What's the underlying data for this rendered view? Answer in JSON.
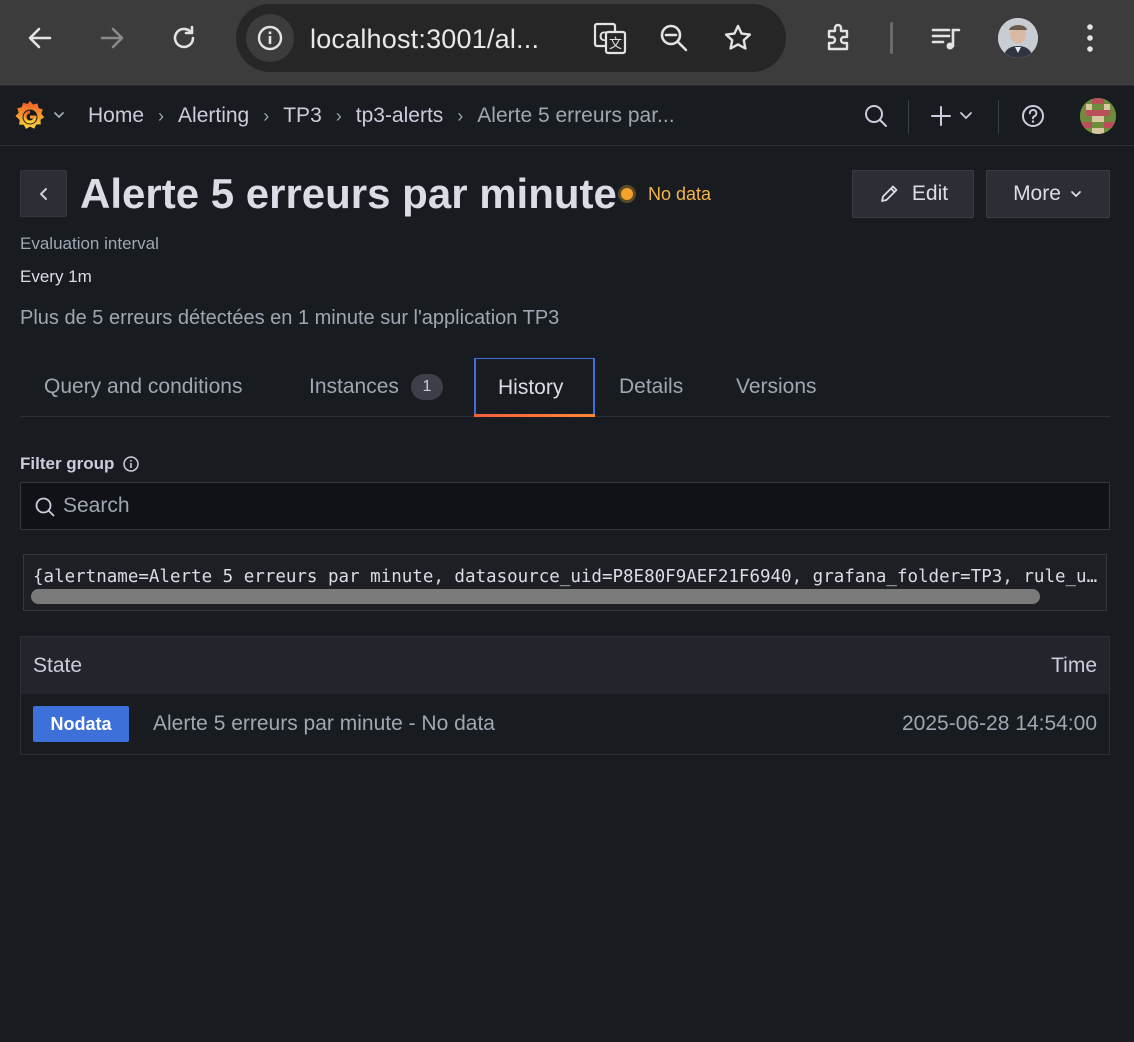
{
  "browser": {
    "url": "localhost:3001/al...",
    "colors": {
      "chrome_bg": "#3c3c3c",
      "omnibox_bg": "#262626"
    }
  },
  "grafana": {
    "breadcrumbs": [
      "Home",
      "Alerting",
      "TP3",
      "tp3-alerts",
      "Alerte 5 erreurs par..."
    ]
  },
  "rule": {
    "title": "Alerte 5 erreurs par minute",
    "state": "No data",
    "edit_label": "Edit",
    "more_label": "More",
    "eval_interval_label": "Evaluation interval",
    "eval_interval_value": "Every 1m",
    "description": "Plus de 5 erreurs détectées en 1 minute sur l'application TP3"
  },
  "tabs": [
    {
      "label": "Query and conditions"
    },
    {
      "label": "Instances",
      "badge": "1"
    },
    {
      "label": "History",
      "active": true
    },
    {
      "label": "Details"
    },
    {
      "label": "Versions"
    }
  ],
  "history": {
    "filter_label": "Filter group",
    "search_placeholder": "Search",
    "labels_text": "{alertname=Alerte 5 erreurs par minute, datasource_uid=P8E80F9AEF21F6940, grafana_folder=TP3, rule_uid=...}",
    "columns": {
      "state": "State",
      "time": "Time"
    },
    "rows": [
      {
        "state": "Nodata",
        "text": "Alerte 5 erreurs par minute - No data",
        "time": "2025-06-28 14:54:00"
      }
    ]
  },
  "colors": {
    "page_bg": "#181b1f",
    "accent_blue": "#3d71d9",
    "nodata_orange": "#f4a328",
    "tab_underline": "#ff8833"
  }
}
